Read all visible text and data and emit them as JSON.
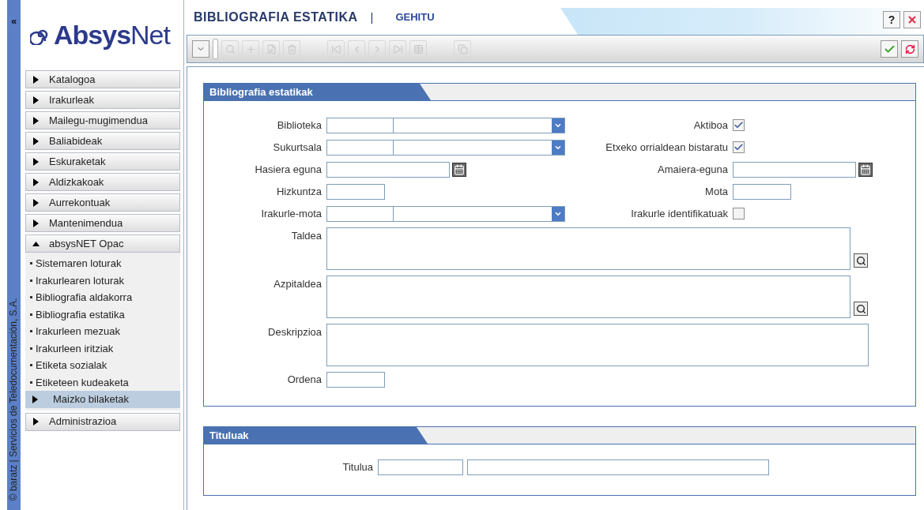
{
  "side_strip": {
    "collapse": "«",
    "credit": "© baratz | Servicios de Teledocumentación, S.A."
  },
  "logo": {
    "bold": "Absys",
    "light": "Net"
  },
  "menu": [
    {
      "label": "Katalogoa",
      "expanded": false
    },
    {
      "label": "Irakurleak",
      "expanded": false
    },
    {
      "label": "Mailegu-mugimendua",
      "expanded": false
    },
    {
      "label": "Baliabideak",
      "expanded": false
    },
    {
      "label": "Eskuraketak",
      "expanded": false
    },
    {
      "label": "Aldizkakoak",
      "expanded": false
    },
    {
      "label": "Aurrekontuak",
      "expanded": false
    },
    {
      "label": "Mantenimendua",
      "expanded": false
    },
    {
      "label": "absysNET Opac",
      "expanded": true,
      "children": [
        {
          "label": "Sistemaren loturak",
          "kind": "link",
          "selected": false
        },
        {
          "label": "Irakurlearen loturak",
          "kind": "link",
          "selected": false
        },
        {
          "label": "Bibliografia aldakorra",
          "kind": "link",
          "selected": false
        },
        {
          "label": "Bibliografia estatika",
          "kind": "link",
          "selected": false
        },
        {
          "label": "Irakurleen mezuak",
          "kind": "link",
          "selected": false
        },
        {
          "label": "Irakurleen iritziak",
          "kind": "link",
          "selected": false
        },
        {
          "label": "Etiketa sozialak",
          "kind": "link",
          "selected": false
        },
        {
          "label": "Etiketeen kudeaketa",
          "kind": "link",
          "selected": false
        },
        {
          "label": "Maizko bilaketak",
          "kind": "submenu",
          "selected": true
        }
      ]
    },
    {
      "label": "Administrazioa",
      "expanded": false
    }
  ],
  "header": {
    "title": "BIBLIOGRAFIA ESTATIKA",
    "separator": "|",
    "mode": "GEHITU",
    "help": "?"
  },
  "toolbar": [
    {
      "kind": "view",
      "disabled": false
    },
    {
      "kind": "grip",
      "disabled": false
    },
    {
      "kind": "search",
      "disabled": true
    },
    {
      "kind": "add",
      "disabled": true
    },
    {
      "kind": "edit",
      "disabled": true
    },
    {
      "kind": "delete",
      "disabled": true
    },
    {
      "kind": "first",
      "disabled": true
    },
    {
      "kind": "prev",
      "disabled": true
    },
    {
      "kind": "next",
      "disabled": true
    },
    {
      "kind": "last",
      "disabled": true
    },
    {
      "kind": "table",
      "disabled": true
    },
    {
      "kind": "copy",
      "disabled": true
    }
  ],
  "panel": {
    "title": "Bibliografia estatikak",
    "rows": [
      {
        "left": {
          "label": "Biblioteka",
          "kind": "select"
        },
        "right": {
          "label": "Aktiboa",
          "kind": "checkbox",
          "checked": true
        }
      },
      {
        "left": {
          "label": "Sukurtsala",
          "kind": "select"
        },
        "right": {
          "label": "Etxeko orrialdean bistaratu",
          "kind": "checkbox",
          "checked": true
        }
      },
      {
        "left": {
          "label": "Hasiera eguna",
          "kind": "date"
        },
        "right": {
          "label": "Amaiera-eguna",
          "kind": "date"
        }
      },
      {
        "left": {
          "label": "Hizkuntza",
          "kind": "short"
        },
        "right": {
          "label": "Mota",
          "kind": "short"
        }
      },
      {
        "left": {
          "label": "Irakurle-mota",
          "kind": "select"
        },
        "right": {
          "label": "Irakurle identifikatuak",
          "kind": "checkbox",
          "checked": false
        }
      }
    ],
    "areas": [
      {
        "label": "Taldea",
        "kind": "lookup"
      },
      {
        "label": "Azpitaldea",
        "kind": "lookup"
      },
      {
        "label": "Deskripzioa",
        "kind": "plain"
      }
    ],
    "order": {
      "label": "Ordena"
    }
  },
  "titles_panel": {
    "title": "Tituluak",
    "field": {
      "label": "Titulua"
    }
  }
}
